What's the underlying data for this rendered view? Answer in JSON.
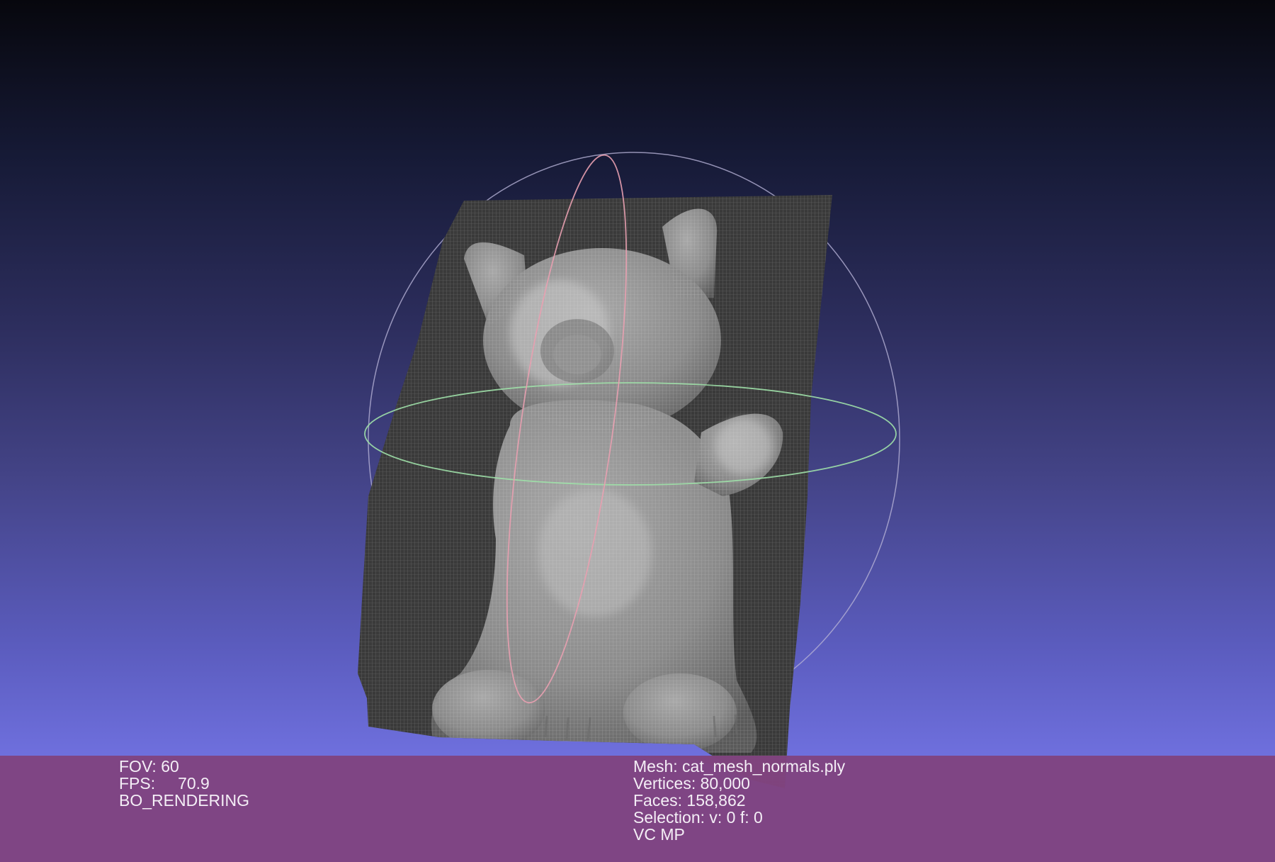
{
  "viewer": {
    "background_top": "#07070d",
    "background_bottom": "#7373e4",
    "info_bar_color": "#804480",
    "trackball_colors": {
      "vertical_ring": "#e8a0b0",
      "horizontal_ring": "#9fe0a8",
      "outer_ring": "#b4b0d4"
    }
  },
  "info": {
    "left": {
      "fov": "FOV: 60",
      "fps": "FPS:     70.9",
      "render_mode": "BO_RENDERING"
    },
    "right": {
      "mesh": "Mesh: cat_mesh_normals.ply",
      "vertices": "Vertices: 80,000",
      "faces": "Faces: 158,862",
      "selection": "Selection: v: 0 f: 0",
      "flags": "VC MP"
    }
  }
}
